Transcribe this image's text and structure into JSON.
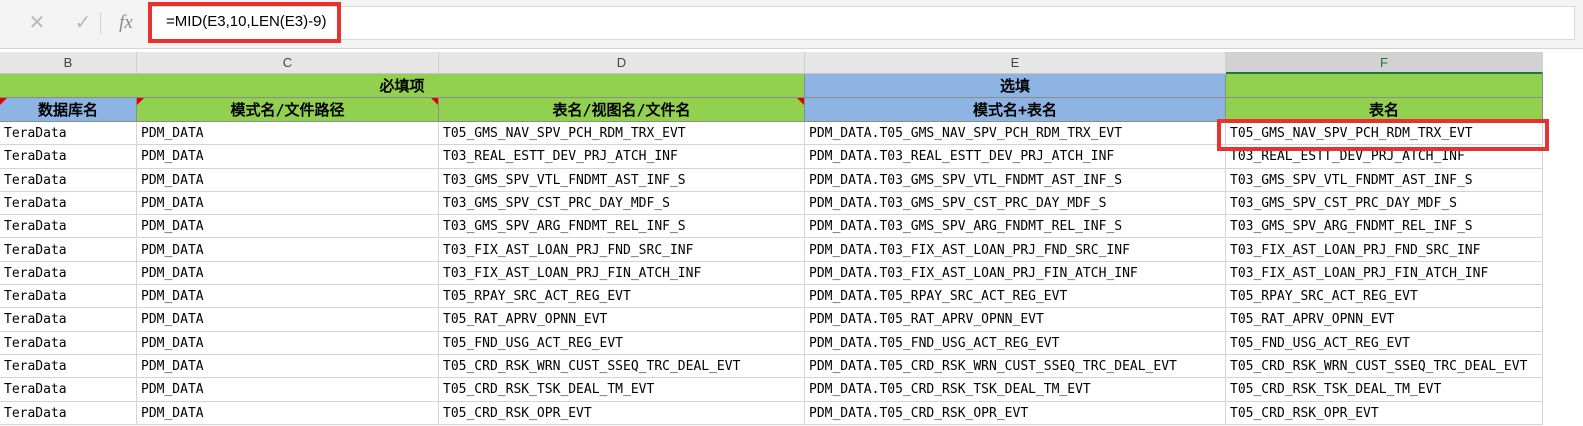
{
  "formula_bar": {
    "cancel_icon": "✕",
    "enter_icon": "✓",
    "fx_label": "fx",
    "formula": "=MID(E3,10,LEN(E3)-9)"
  },
  "columns": [
    "B",
    "C",
    "D",
    "E",
    "F"
  ],
  "header_bands": {
    "required": "必填项",
    "optional": "选填"
  },
  "headers": {
    "b": "数据库名",
    "c": "模式名/文件路径",
    "d": "表名/视图名/文件名",
    "e": "模式名+表名",
    "f": "表名"
  },
  "rows": [
    {
      "b": "TeraData",
      "c": "PDM_DATA",
      "d": "T05_GMS_NAV_SPV_PCH_RDM_TRX_EVT",
      "e": "PDM_DATA.T05_GMS_NAV_SPV_PCH_RDM_TRX_EVT",
      "f": "T05_GMS_NAV_SPV_PCH_RDM_TRX_EVT"
    },
    {
      "b": "TeraData",
      "c": "PDM_DATA",
      "d": "T03_REAL_ESTT_DEV_PRJ_ATCH_INF",
      "e": "PDM_DATA.T03_REAL_ESTT_DEV_PRJ_ATCH_INF",
      "f": "T03_REAL_ESTT_DEV_PRJ_ATCH_INF"
    },
    {
      "b": "TeraData",
      "c": "PDM_DATA",
      "d": "T03_GMS_SPV_VTL_FNDMT_AST_INF_S",
      "e": "PDM_DATA.T03_GMS_SPV_VTL_FNDMT_AST_INF_S",
      "f": "T03_GMS_SPV_VTL_FNDMT_AST_INF_S"
    },
    {
      "b": "TeraData",
      "c": "PDM_DATA",
      "d": "T03_GMS_SPV_CST_PRC_DAY_MDF_S",
      "e": "PDM_DATA.T03_GMS_SPV_CST_PRC_DAY_MDF_S",
      "f": "T03_GMS_SPV_CST_PRC_DAY_MDF_S"
    },
    {
      "b": "TeraData",
      "c": "PDM_DATA",
      "d": "T03_GMS_SPV_ARG_FNDMT_REL_INF_S",
      "e": "PDM_DATA.T03_GMS_SPV_ARG_FNDMT_REL_INF_S",
      "f": "T03_GMS_SPV_ARG_FNDMT_REL_INF_S"
    },
    {
      "b": "TeraData",
      "c": "PDM_DATA",
      "d": "T03_FIX_AST_LOAN_PRJ_FND_SRC_INF",
      "e": "PDM_DATA.T03_FIX_AST_LOAN_PRJ_FND_SRC_INF",
      "f": "T03_FIX_AST_LOAN_PRJ_FND_SRC_INF"
    },
    {
      "b": "TeraData",
      "c": "PDM_DATA",
      "d": "T03_FIX_AST_LOAN_PRJ_FIN_ATCH_INF",
      "e": "PDM_DATA.T03_FIX_AST_LOAN_PRJ_FIN_ATCH_INF",
      "f": "T03_FIX_AST_LOAN_PRJ_FIN_ATCH_INF"
    },
    {
      "b": "TeraData",
      "c": "PDM_DATA",
      "d": "T05_RPAY_SRC_ACT_REG_EVT",
      "e": "PDM_DATA.T05_RPAY_SRC_ACT_REG_EVT",
      "f": "T05_RPAY_SRC_ACT_REG_EVT"
    },
    {
      "b": "TeraData",
      "c": "PDM_DATA",
      "d": "T05_RAT_APRV_OPNN_EVT",
      "e": "PDM_DATA.T05_RAT_APRV_OPNN_EVT",
      "f": "T05_RAT_APRV_OPNN_EVT"
    },
    {
      "b": "TeraData",
      "c": "PDM_DATA",
      "d": "T05_FND_USG_ACT_REG_EVT",
      "e": "PDM_DATA.T05_FND_USG_ACT_REG_EVT",
      "f": "T05_FND_USG_ACT_REG_EVT"
    },
    {
      "b": "TeraData",
      "c": "PDM_DATA",
      "d": "T05_CRD_RSK_WRN_CUST_SSEQ_TRC_DEAL_EVT",
      "e": "PDM_DATA.T05_CRD_RSK_WRN_CUST_SSEQ_TRC_DEAL_EVT",
      "f": "T05_CRD_RSK_WRN_CUST_SSEQ_TRC_DEAL_EVT"
    },
    {
      "b": "TeraData",
      "c": "PDM_DATA",
      "d": "T05_CRD_RSK_TSK_DEAL_TM_EVT",
      "e": "PDM_DATA.T05_CRD_RSK_TSK_DEAL_TM_EVT",
      "f": "T05_CRD_RSK_TSK_DEAL_TM_EVT"
    },
    {
      "b": "TeraData",
      "c": "PDM_DATA",
      "d": "T05_CRD_RSK_OPR_EVT",
      "e": "PDM_DATA.T05_CRD_RSK_OPR_EVT",
      "f": "T05_CRD_RSK_OPR_EVT"
    }
  ],
  "colors": {
    "required_fill": "#92d050",
    "optional_fill": "#8db4e2",
    "highlight_border": "#e8322f"
  }
}
